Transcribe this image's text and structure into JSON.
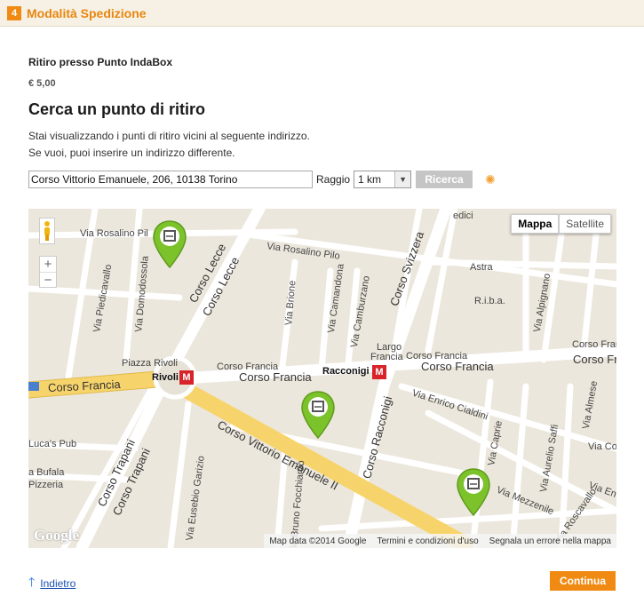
{
  "step": {
    "number": "4",
    "title": "Modalità Spedizione"
  },
  "method": {
    "name": "Ritiro presso Punto IndaBox",
    "price": "€ 5,00"
  },
  "section_title": "Cerca un punto di ritiro",
  "info": {
    "line1": "Stai visualizzando i punti di ritiro vicini al seguente indirizzo.",
    "line2": "Se vuoi, puoi inserire un indirizzo differente."
  },
  "search": {
    "address_value": "Corso Vittorio Emanuele, 206, 10138 Torino",
    "radius_label": "Raggio",
    "radius_selected": "1 km",
    "button_label": "Ricerca"
  },
  "map": {
    "type_buttons": {
      "map": "Mappa",
      "satellite": "Satellite"
    },
    "zoom_in": "+",
    "zoom_out": "−",
    "metro_symbol": "M",
    "labels": {
      "via_rosalino_pilo_left": "Via Rosalino Pil",
      "via_rosalino_pilo_right": "Via Rosalino Pilo",
      "via_domodossola": "Via Domodossola",
      "via_piedicavallo": "Via Piedicavallo",
      "corso_lecce_1": "Corso Lecce",
      "corso_lecce_2": "Corso Lecce",
      "piazza_rivoli": "Piazza Rivoli",
      "rivoli": "Rivoli",
      "racconigi": "Racconigi",
      "corso_francia_left": "Corso Francia",
      "corso_francia_mid1": "Corso Francia",
      "corso_francia_mid2": "Corso Francia",
      "corso_francia_right1": "Corso Francia",
      "corso_francia_right2": "Corso Franc",
      "corso_francia_right3": "Corso Fran",
      "largo_francia_1": "Largo",
      "largo_francia_2": "Francia",
      "via_brione": "Via Brione",
      "via_camandona": "Via Camandona",
      "via_camburzano": "Via Camburzano",
      "corso_svizzera": "Corso Svizzera",
      "astra": "Astra",
      "riba": "R.i.b.a.",
      "via_alpignano": "Via Alpignano",
      "via_enrico_cialdini": "Via Enrico Cialdini",
      "corso_racconigi": "Corso Racconigi",
      "corso_vittorio": "Corso Vittorio Emanuele II",
      "lucas_pub": "Luca's Pub",
      "la_bufala": "a Bufala",
      "pizzeria": "Pizzeria",
      "corso_trapani_1": "Corso Trapani",
      "corso_trapani_2": "Corso Trapani",
      "via_eusebio_garizio": "Via Eusebio Garizio",
      "via_fochiardo": "Via Bruno Focchiardo",
      "via_caprie": "Via Caprie",
      "via_aurelio_saffi": "Via Aurelio Saffi",
      "via_almese": "Via Almese",
      "via_mezzenile": "Via Mezzenile",
      "via_coazze": "Via Coa",
      "via_envie": "Via Envi",
      "via_roscavallo": "Via Roscavallo",
      "via_medici": "edici",
      "corso_trap_top": "Via"
    },
    "google": "Google",
    "footer": {
      "map_data": "Map data ©2014 Google",
      "terms": "Termini e condizioni d'uso",
      "report": "Segnala un errore nella mappa"
    }
  },
  "nav": {
    "back": "Indietro",
    "continue": "Continua"
  },
  "colors": {
    "accent": "#f08a12",
    "pin": "#7cc22b",
    "metro": "#d8232a",
    "main_road": "#f7d46b"
  }
}
